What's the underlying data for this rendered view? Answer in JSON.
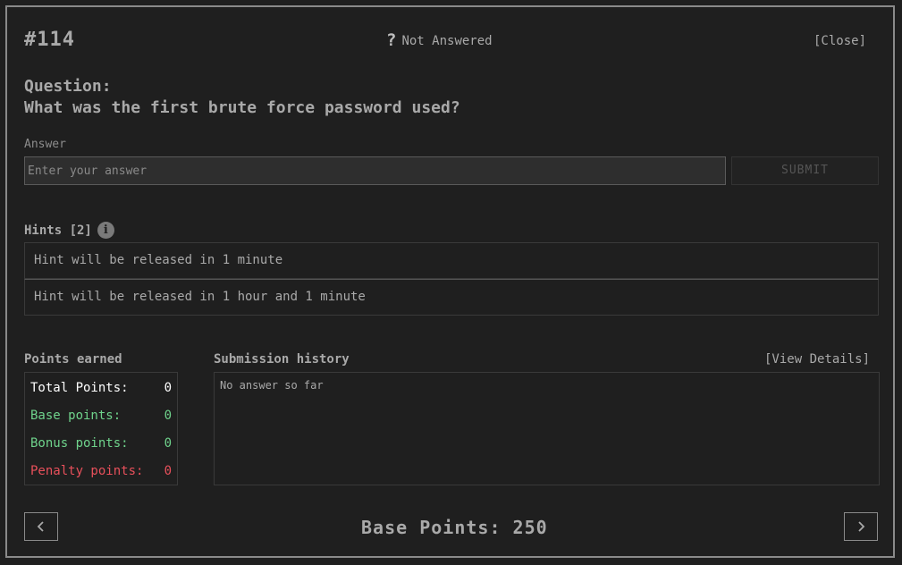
{
  "header": {
    "question_id": "#114",
    "status_icon": "question-mark-icon",
    "status_text": "Not Answered",
    "close_label": "[Close]"
  },
  "question": {
    "label": "Question:",
    "text": "What was the first brute force password used?"
  },
  "answer": {
    "label": "Answer",
    "placeholder": "Enter your answer",
    "value": "",
    "submit_label": "SUBMIT"
  },
  "hints": {
    "title": "Hints [2]",
    "info_icon": "info-icon",
    "items": [
      {
        "text": "Hint will be released in 1 minute"
      },
      {
        "text": "Hint will be released in 1 hour and 1 minute"
      }
    ]
  },
  "points": {
    "title": "Points earned",
    "total_label": "Total Points:",
    "total_value": "0",
    "base_label": "Base points:",
    "base_value": "0",
    "bonus_label": "Bonus points:",
    "bonus_value": "0",
    "penalty_label": "Penalty points:",
    "penalty_value": "0"
  },
  "history": {
    "title": "Submission history",
    "view_details_label": "[View Details]",
    "empty_text": "No answer so far"
  },
  "footer": {
    "base_points_text": "Base Points: 250",
    "prev_icon": "chevron-left-icon",
    "next_icon": "chevron-right-icon"
  },
  "colors": {
    "background": "#1f1f1f",
    "text": "#a9a9a9",
    "positive": "#6fd38c",
    "negative": "#e8505b"
  }
}
